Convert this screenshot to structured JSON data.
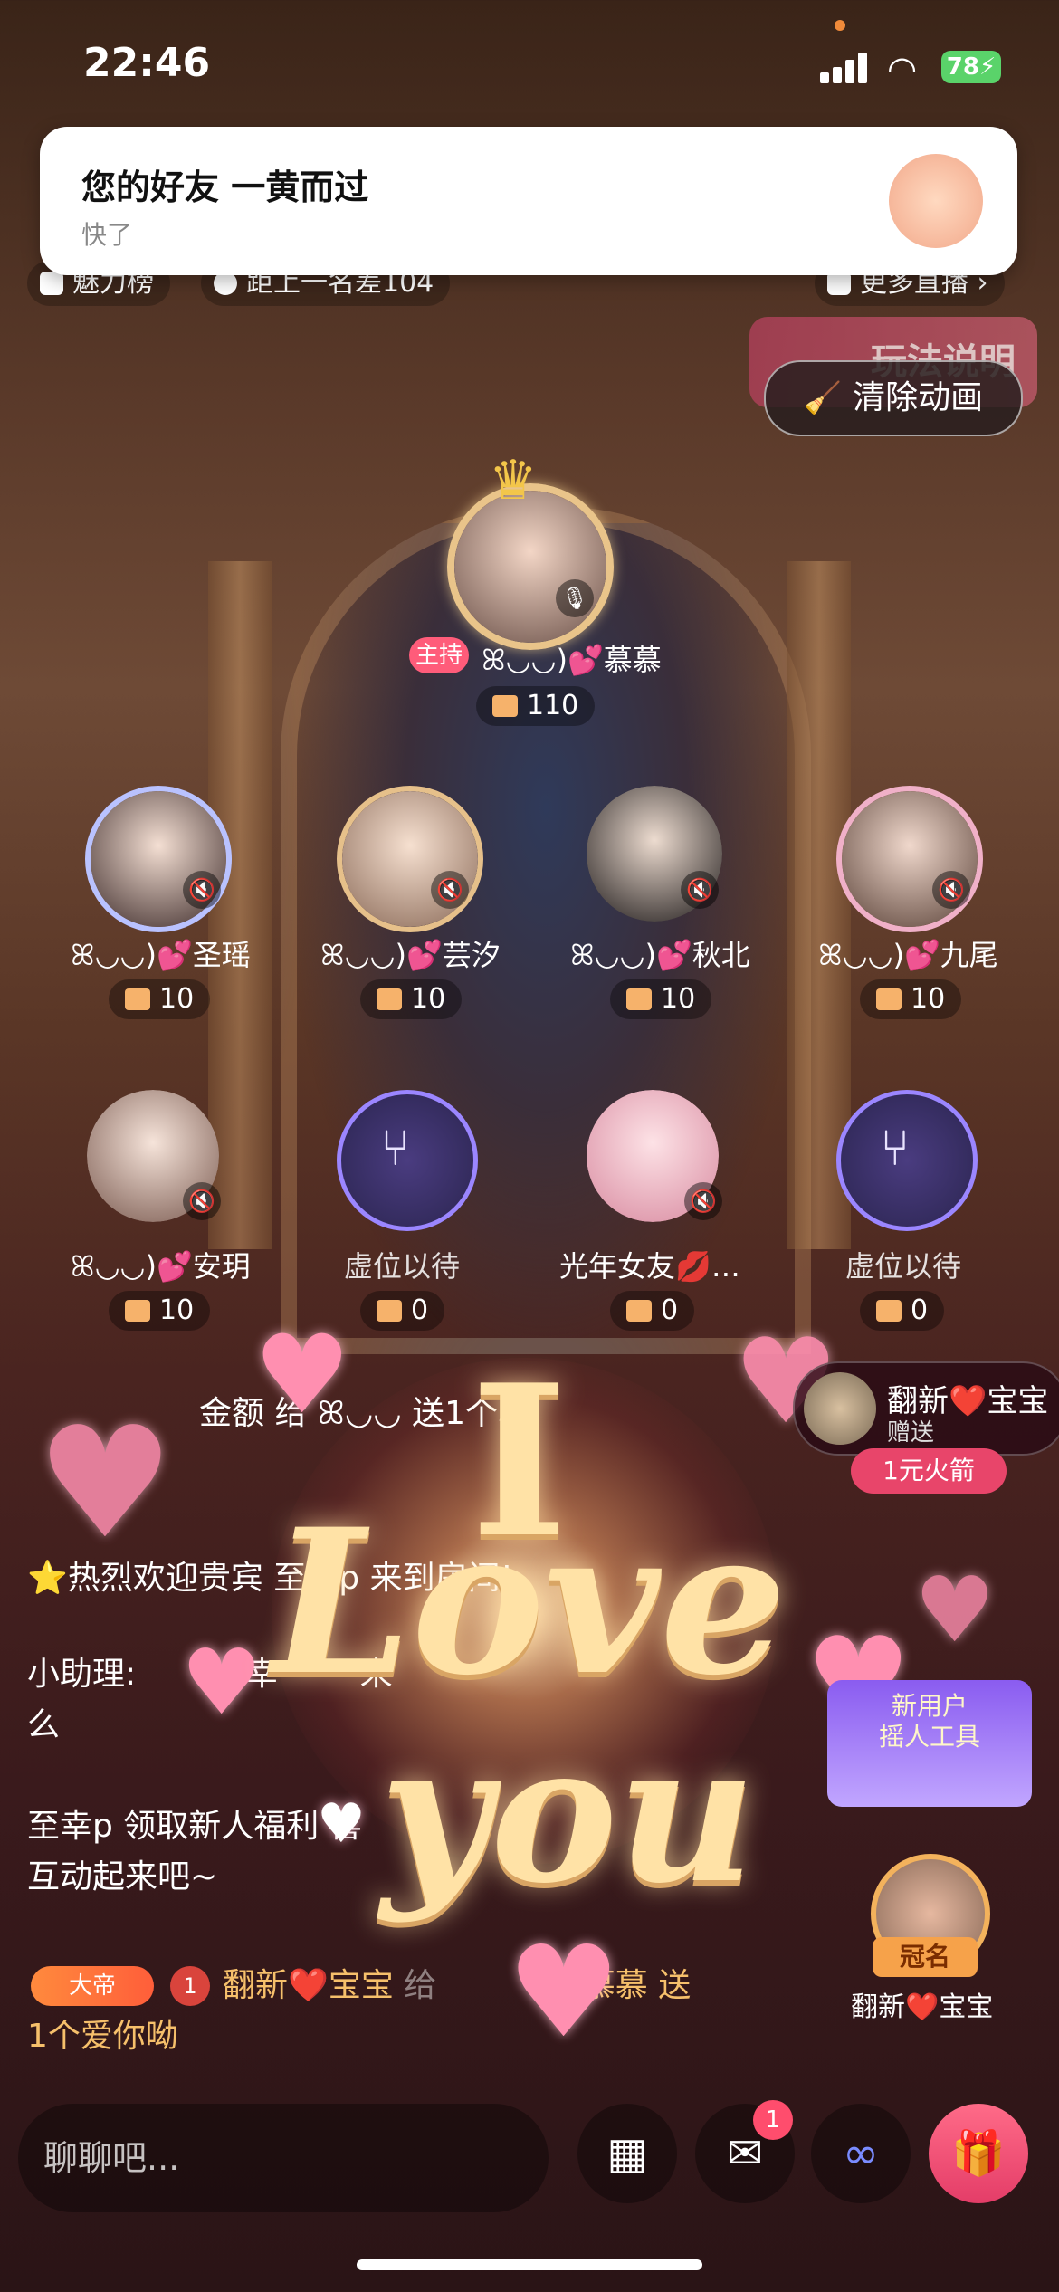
{
  "status": {
    "time": "22:46",
    "battery": "78"
  },
  "notification": {
    "title": "您的好友 一黄而过",
    "subtitle": "快了"
  },
  "top": {
    "charm": "魅力榜",
    "rank_gap": "距上一名差104",
    "more_live": "更多直播",
    "rules": "玩法说明",
    "clear_anim": "清除动画"
  },
  "host": {
    "tag": "主持",
    "name": "ꕤ◡◡)💕慕慕",
    "gifts": "110"
  },
  "seats_row1": [
    {
      "name": "ꕤ◡◡)💕圣瑶",
      "gifts": "10"
    },
    {
      "name": "ꕤ◡◡)💕芸汐",
      "gifts": "10"
    },
    {
      "name": "ꕤ◡◡)💕秋北",
      "gifts": "10"
    },
    {
      "name": "ꕤ◡◡)💕九尾",
      "gifts": "10"
    }
  ],
  "seats_row2": [
    {
      "name": "ꕤ◡◡)💕安玥",
      "gifts": "10"
    },
    {
      "name": "虚位以待",
      "gifts": "0"
    },
    {
      "name": "光年女友💋…",
      "gifts": "0"
    },
    {
      "name": "虚位以待",
      "gifts": "0"
    }
  ],
  "chat": {
    "line1": "金额 给 ꕤ◡◡ 送1个心",
    "line2": "⭐热烈欢迎贵宾 至幸p 来到房间!",
    "line3a": "小助理:",
    "line3b": "幸",
    "line3c": "来",
    "line3d": "么",
    "line4a": "至幸p 领取新人福利 喜",
    "line4b": "互动起来吧~",
    "gift_badge": "大帝",
    "gift_level": "1",
    "gift_user": "翻新❤️宝宝",
    "gift_to": "给",
    "gift_target": "慕慕",
    "gift_send": "送",
    "gift_item": "1个爱你呦"
  },
  "overlay": {
    "love_i": "I",
    "love_love": "Love",
    "love_you": "you"
  },
  "gift_pop": {
    "name": "翻新❤️宝宝",
    "action": "赠送",
    "gift": "1元火箭"
  },
  "promo": {
    "label": "新用户\n摇人工具"
  },
  "crown": {
    "tag": "冠名",
    "name": "翻新❤️宝宝"
  },
  "bottom": {
    "placeholder": "聊聊吧...",
    "badge": "1"
  }
}
